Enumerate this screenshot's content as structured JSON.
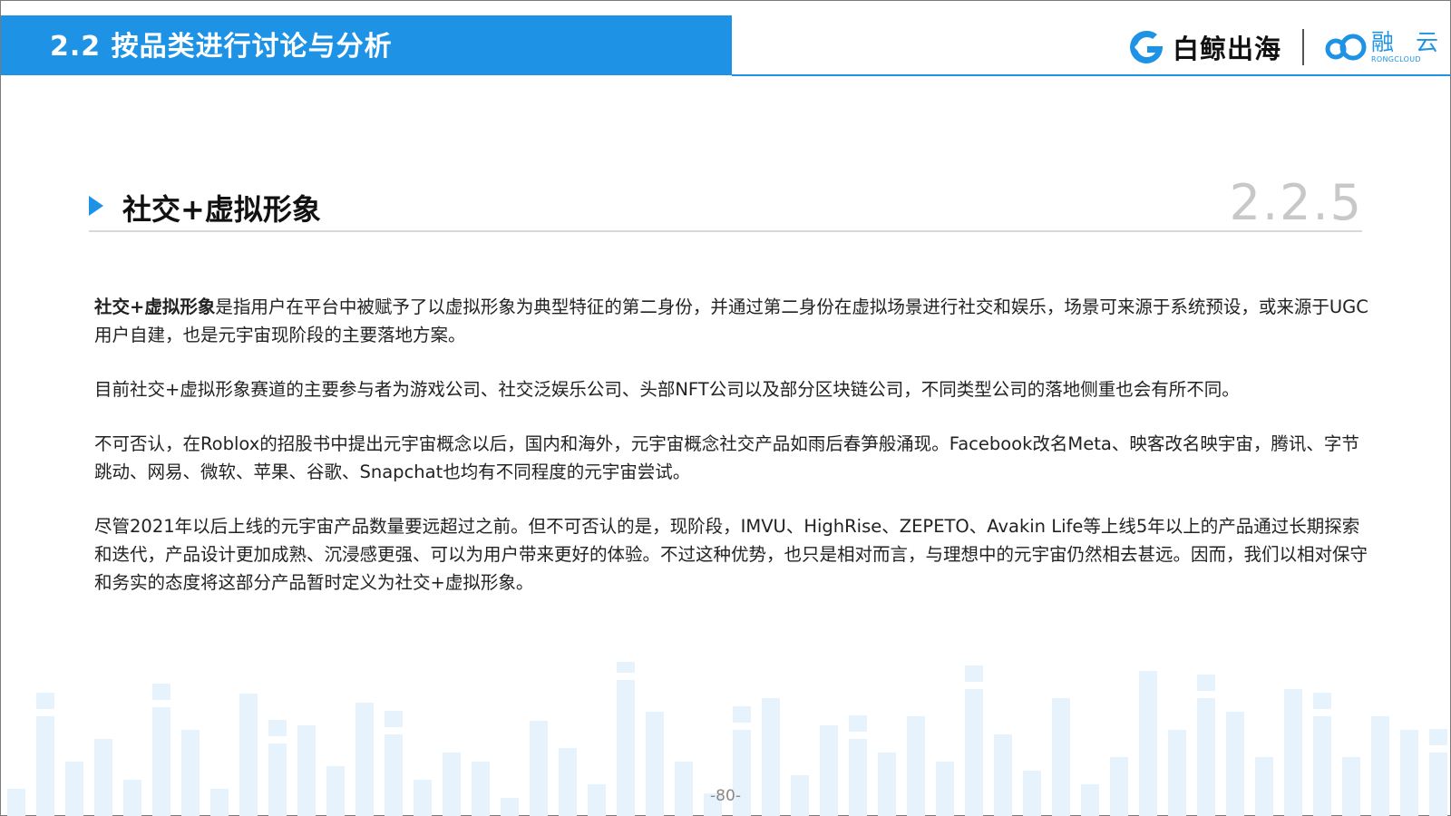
{
  "header": {
    "title": "2.2 按品类进行讨论与分析",
    "logos": {
      "baijing": "白鲸出海",
      "rongcloud_cn": "融 云",
      "rongcloud_en": "RONGCLOUD"
    }
  },
  "section": {
    "title": "社交+虚拟形象",
    "number": "2.2.5"
  },
  "paragraphs": [
    {
      "bold_lead": "社交+虚拟形象",
      "text": "是指用户在平台中被赋予了以虚拟形象为典型特征的第二身份，并通过第二身份在虚拟场景进行社交和娱乐，场景可来源于系统预设，或来源于UGC用户自建，也是元宇宙现阶段的主要落地方案。"
    },
    {
      "bold_lead": "",
      "text": "目前社交+虚拟形象赛道的主要参与者为游戏公司、社交泛娱乐公司、头部NFT公司以及部分区块链公司，不同类型公司的落地侧重也会有所不同。"
    },
    {
      "bold_lead": "",
      "text": "不可否认，在Roblox的招股书中提出元宇宙概念以后，国内和海外，元宇宙概念社交产品如雨后春笋般涌现。Facebook改名Meta、映客改名映宇宙，腾讯、字节跳动、网易、微软、苹果、谷歌、Snapchat也均有不同程度的元宇宙尝试。"
    },
    {
      "bold_lead": "",
      "text": "尽管2021年以后上线的元宇宙产品数量要远超过之前。但不可否认的是，现阶段，IMVU、HighRise、ZEPETO、Avakin Life等上线5年以上的产品通过长期探索和迭代，产品设计更加成熟、沉浸感更强、可以为用户带来更好的体验。不过这种优势，也只是相对而言，与理想中的元宇宙仍然相去甚远。因而，我们以相对保守和务实的态度将这部分产品暂时定义为社交+虚拟形象。"
    }
  ],
  "footer": {
    "page_number": "-80-"
  },
  "colors": {
    "accent": "#1e93e6",
    "bars": "#e6f2fc"
  }
}
